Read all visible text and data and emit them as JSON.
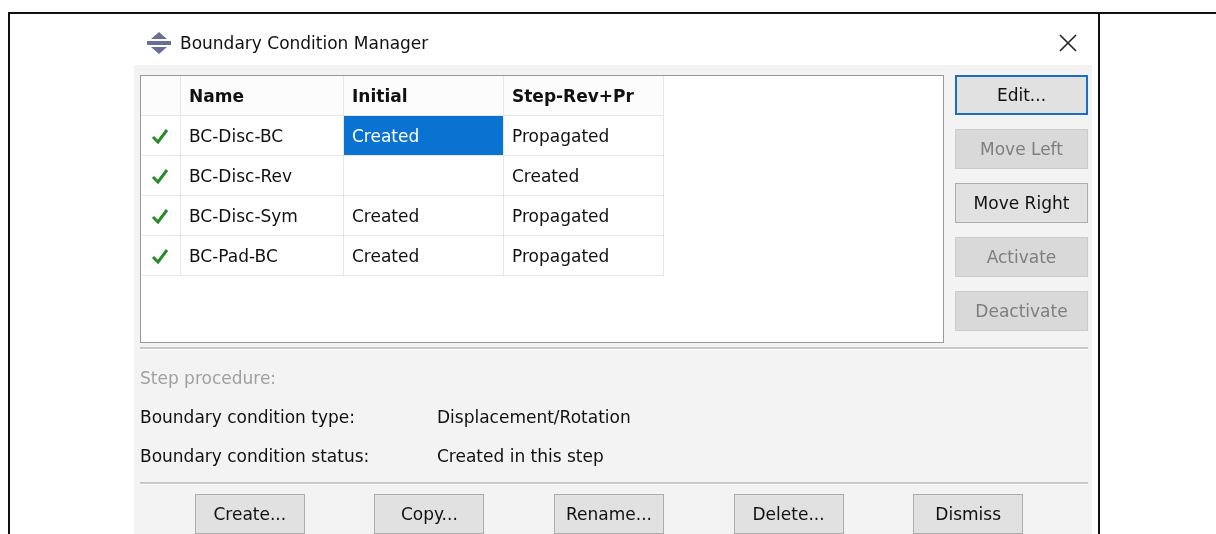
{
  "window": {
    "title": "Boundary Condition Manager"
  },
  "table": {
    "columns": [
      "Name",
      "Initial",
      "Step-Rev+Pr"
    ],
    "rows": [
      {
        "active": true,
        "cells": [
          {
            "text": "BC-Disc-BC",
            "selected": false
          },
          {
            "text": "Created",
            "selected": true
          },
          {
            "text": "Propagated",
            "selected": false
          }
        ]
      },
      {
        "active": true,
        "cells": [
          {
            "text": "BC-Disc-Rev",
            "selected": false
          },
          {
            "selected": false
          },
          {
            "text": "Created",
            "selected": false
          }
        ]
      },
      {
        "active": true,
        "cells": [
          {
            "text": "BC-Disc-Sym",
            "selected": false
          },
          {
            "text": "Created",
            "selected": false
          },
          {
            "text": "Propagated",
            "selected": false
          }
        ]
      },
      {
        "active": true,
        "cells": [
          {
            "text": "BC-Pad-BC",
            "selected": false
          },
          {
            "text": "Created",
            "selected": false
          },
          {
            "text": "Propagated",
            "selected": false
          }
        ]
      }
    ]
  },
  "side_buttons": [
    {
      "label": "Edit...",
      "disabled": false,
      "focused": true
    },
    {
      "label": "Move Left",
      "disabled": true,
      "focused": false
    },
    {
      "label": "Move Right",
      "disabled": false,
      "focused": false
    },
    {
      "label": "Activate",
      "disabled": true,
      "focused": false
    },
    {
      "label": "Deactivate",
      "disabled": true,
      "focused": false
    }
  ],
  "details": [
    {
      "label": "Step procedure:",
      "disabled": true
    },
    {
      "label": "Boundary condition type:",
      "value": "Displacement/Rotation",
      "disabled": false
    },
    {
      "label": "Boundary condition status:",
      "value": "Created in this step",
      "disabled": false
    }
  ],
  "bottom_buttons": [
    "Create...",
    "Copy...",
    "Rename...",
    "Delete...",
    "Dismiss"
  ]
}
